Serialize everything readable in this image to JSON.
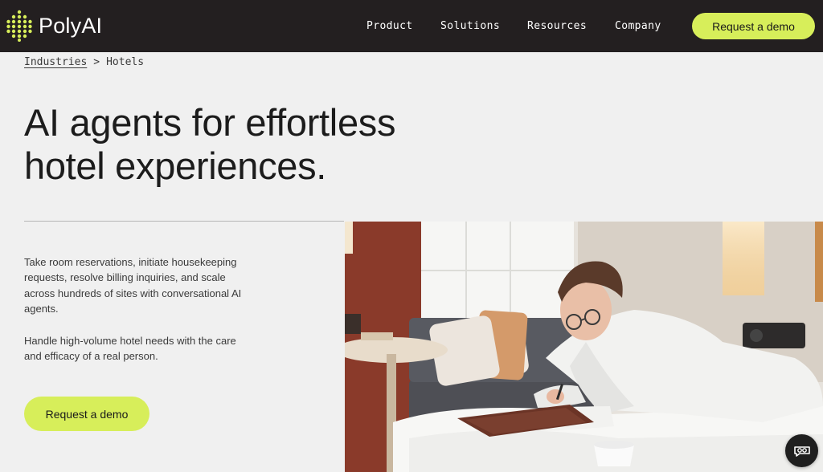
{
  "brand": {
    "name": "PolyAI"
  },
  "nav": {
    "items": [
      {
        "label": "Product"
      },
      {
        "label": "Solutions"
      },
      {
        "label": "Resources"
      },
      {
        "label": "Company"
      }
    ],
    "cta_label": "Request a demo"
  },
  "breadcrumb": {
    "parent": "Industries",
    "separator": ">",
    "current": "Hotels"
  },
  "hero": {
    "title_line1": "AI agents for effortless",
    "title_line2": "hotel experiences.",
    "paragraph1": "Take room reservations, initiate housekeeping requests, resolve billing inquiries, and scale across hundreds of sites with conversational AI agents.",
    "paragraph2": "Handle high-volume hotel needs with the care and efficacy of a real person.",
    "cta_label": "Request a demo"
  },
  "colors": {
    "header_bg": "#231f20",
    "accent": "#d7ee5a",
    "page_bg": "#f0f0f0"
  },
  "icons": {
    "logo": "polyai-dot-grid-logo",
    "chat": "chat-bubble-icon"
  }
}
